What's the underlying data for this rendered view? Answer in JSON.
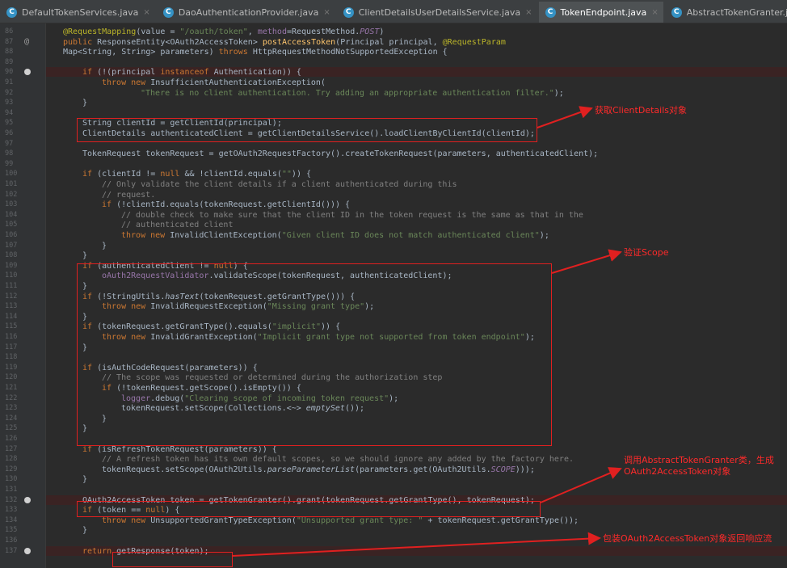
{
  "tabs": [
    {
      "label": "DefaultTokenServices.java",
      "active": false
    },
    {
      "label": "DaoAuthenticationProvider.java",
      "active": false
    },
    {
      "label": "ClientDetailsUserDetailsService.java",
      "active": false
    },
    {
      "label": "TokenEndpoint.java",
      "active": true
    },
    {
      "label": "AbstractTokenGranter.java",
      "active": false
    }
  ],
  "line_numbers": [
    "86",
    "87",
    "88",
    "89",
    "90",
    "91",
    "92",
    "93",
    "94",
    "95",
    "96",
    "97",
    "98",
    "99",
    "100",
    "101",
    "102",
    "103",
    "104",
    "105",
    "106",
    "107",
    "108",
    "109",
    "110",
    "111",
    "112",
    "113",
    "114",
    "115",
    "116",
    "117",
    "118",
    "119",
    "120",
    "121",
    "122",
    "123",
    "124",
    "125",
    "126",
    "127",
    "128",
    "129",
    "130",
    "131",
    "132",
    "133",
    "134",
    "135",
    "136",
    "137"
  ],
  "breakpoint_lines": [
    "90",
    "132",
    "137"
  ],
  "annotation_glyph": "@",
  "code_tokens": [
    [
      "a1",
      [
        "ind",
        0
      ],
      [
        "an",
        "@RequestMapping"
      ],
      [
        "t",
        "(value = "
      ],
      [
        "str",
        "\"/oauth/token\""
      ],
      [
        "t",
        ", "
      ],
      [
        "fld",
        "method"
      ],
      [
        "t",
        "=RequestMethod."
      ],
      [
        "it",
        "POST"
      ],
      [
        "t",
        ")"
      ]
    ],
    [
      "a2",
      [
        "ind",
        0
      ],
      [
        "kw",
        "public "
      ],
      [
        "t",
        "ResponseEntity<OAuth2AccessToken> "
      ],
      [
        "fn",
        "postAccessToken"
      ],
      [
        "t",
        "(Principal principal, "
      ],
      [
        "an",
        "@RequestParam"
      ]
    ],
    [
      "a3",
      [
        "ind",
        0
      ],
      [
        "t",
        "Map<String, String> parameters) "
      ],
      [
        "kw",
        "throws "
      ],
      [
        "t",
        "HttpRequestMethodNotSupportedException {"
      ]
    ],
    [
      "a4"
    ],
    [
      "a5",
      [
        "ind",
        1
      ],
      [
        "kw",
        "if "
      ],
      [
        "t",
        "(!(principal "
      ],
      [
        "kw",
        "instanceof "
      ],
      [
        "t",
        "Authentication)) {"
      ]
    ],
    [
      "a6",
      [
        "ind",
        2
      ],
      [
        "kw",
        "throw new "
      ],
      [
        "t",
        "InsufficientAuthenticationException("
      ]
    ],
    [
      "a7",
      [
        "ind",
        4
      ],
      [
        "str",
        "\"There is no client authentication. Try adding an appropriate authentication filter.\""
      ],
      [
        "t",
        ");"
      ]
    ],
    [
      "a8",
      [
        "ind",
        1
      ],
      [
        "t",
        "}"
      ]
    ],
    [
      "a9"
    ],
    [
      "a10",
      [
        "ind",
        1
      ],
      [
        "t",
        "String clientId = getClientId(principal);"
      ]
    ],
    [
      "a11",
      [
        "ind",
        1
      ],
      [
        "t",
        "ClientDetails authenticatedClient = getClientDetailsService().loadClientByClientId(clientId);"
      ]
    ],
    [
      "a12"
    ],
    [
      "a13",
      [
        "ind",
        1
      ],
      [
        "t",
        "TokenRequest tokenRequest = getOAuth2RequestFactory().createTokenRequest(parameters, authenticatedClient);"
      ]
    ],
    [
      "a14"
    ],
    [
      "a15",
      [
        "ind",
        1
      ],
      [
        "kw",
        "if "
      ],
      [
        "t",
        "(clientId != "
      ],
      [
        "kw",
        "null "
      ],
      [
        "t",
        "&& !clientId.equals("
      ],
      [
        "str",
        "\"\""
      ],
      [
        "t",
        ")) {"
      ]
    ],
    [
      "a16",
      [
        "ind",
        2
      ],
      [
        "cm",
        "// Only validate the client details if a client authenticated during this"
      ]
    ],
    [
      "a17",
      [
        "ind",
        2
      ],
      [
        "cm",
        "// request."
      ]
    ],
    [
      "a18",
      [
        "ind",
        2
      ],
      [
        "kw",
        "if "
      ],
      [
        "t",
        "(!clientId.equals(tokenRequest.getClientId())) {"
      ]
    ],
    [
      "a19",
      [
        "ind",
        3
      ],
      [
        "cm",
        "// double check to make sure that the client ID in the token request is the same as that in the"
      ]
    ],
    [
      "a20",
      [
        "ind",
        3
      ],
      [
        "cm",
        "// authenticated client"
      ]
    ],
    [
      "a21",
      [
        "ind",
        3
      ],
      [
        "kw",
        "throw new "
      ],
      [
        "t",
        "InvalidClientException("
      ],
      [
        "str",
        "\"Given client ID does not match authenticated client\""
      ],
      [
        "t",
        ");"
      ]
    ],
    [
      "a22",
      [
        "ind",
        2
      ],
      [
        "t",
        "}"
      ]
    ],
    [
      "a23",
      [
        "ind",
        1
      ],
      [
        "t",
        "}"
      ]
    ],
    [
      "a24",
      [
        "ind",
        1
      ],
      [
        "kw",
        "if "
      ],
      [
        "t",
        "(authenticatedClient != "
      ],
      [
        "kw",
        "null"
      ],
      [
        "t",
        ") {"
      ]
    ],
    [
      "a25",
      [
        "ind",
        2
      ],
      [
        "fld",
        "oAuth2RequestValidator"
      ],
      [
        "t",
        ".validateScope(tokenRequest, authenticatedClient);"
      ]
    ],
    [
      "a26",
      [
        "ind",
        1
      ],
      [
        "t",
        "}"
      ]
    ],
    [
      "a27",
      [
        "ind",
        1
      ],
      [
        "kw",
        "if "
      ],
      [
        "t",
        "(!StringUtils."
      ],
      [
        "sm",
        "hasText"
      ],
      [
        "t",
        "(tokenRequest.getGrantType())) {"
      ]
    ],
    [
      "a28",
      [
        "ind",
        2
      ],
      [
        "kw",
        "throw new "
      ],
      [
        "t",
        "InvalidRequestException("
      ],
      [
        "str",
        "\"Missing grant type\""
      ],
      [
        "t",
        ");"
      ]
    ],
    [
      "a29",
      [
        "ind",
        1
      ],
      [
        "t",
        "}"
      ]
    ],
    [
      "a30",
      [
        "ind",
        1
      ],
      [
        "kw",
        "if "
      ],
      [
        "t",
        "(tokenRequest.getGrantType().equals("
      ],
      [
        "str",
        "\"implicit\""
      ],
      [
        "t",
        ")) {"
      ]
    ],
    [
      "a31",
      [
        "ind",
        2
      ],
      [
        "kw",
        "throw new "
      ],
      [
        "t",
        "InvalidGrantException("
      ],
      [
        "str",
        "\"Implicit grant type not supported from token endpoint\""
      ],
      [
        "t",
        ");"
      ]
    ],
    [
      "a32",
      [
        "ind",
        1
      ],
      [
        "t",
        "}"
      ]
    ],
    [
      "a33"
    ],
    [
      "a34",
      [
        "ind",
        1
      ],
      [
        "kw",
        "if "
      ],
      [
        "t",
        "(isAuthCodeRequest(parameters)) {"
      ]
    ],
    [
      "a35",
      [
        "ind",
        2
      ],
      [
        "cm",
        "// The scope was requested or determined during the authorization step"
      ]
    ],
    [
      "a36",
      [
        "ind",
        2
      ],
      [
        "kw",
        "if "
      ],
      [
        "t",
        "(!tokenRequest.getScope().isEmpty()) {"
      ]
    ],
    [
      "a37",
      [
        "ind",
        3
      ],
      [
        "fld",
        "logger"
      ],
      [
        "t",
        ".debug("
      ],
      [
        "str",
        "\"Clearing scope of incoming token request\""
      ],
      [
        "t",
        ");"
      ]
    ],
    [
      "a38",
      [
        "ind",
        3
      ],
      [
        "t",
        "tokenRequest.setScope(Collections."
      ],
      [
        "t",
        "<~>"
      ],
      [
        "sm",
        " emptySet"
      ],
      [
        "t",
        "());"
      ]
    ],
    [
      "a39",
      [
        "ind",
        2
      ],
      [
        "t",
        "}"
      ]
    ],
    [
      "a40",
      [
        "ind",
        1
      ],
      [
        "t",
        "}"
      ]
    ],
    [
      "a41"
    ],
    [
      "a42",
      [
        "ind",
        1
      ],
      [
        "kw",
        "if "
      ],
      [
        "t",
        "(isRefreshTokenRequest(parameters)) {"
      ]
    ],
    [
      "a43",
      [
        "ind",
        2
      ],
      [
        "cm",
        "// A refresh token has its own default scopes, so we should ignore any added by the factory here."
      ]
    ],
    [
      "a44",
      [
        "ind",
        2
      ],
      [
        "t",
        "tokenRequest.setScope(OAuth2Utils."
      ],
      [
        "sm",
        "parseParameterList"
      ],
      [
        "t",
        "(parameters.get(OAuth2Utils."
      ],
      [
        "it",
        "SCOPE"
      ],
      [
        "t",
        ")));"
      ]
    ],
    [
      "a45",
      [
        "ind",
        1
      ],
      [
        "t",
        "}"
      ]
    ],
    [
      "a46"
    ],
    [
      "a47",
      [
        "ind",
        1
      ],
      [
        "t",
        "OAuth2AccessToken token = getTokenGranter().grant(tokenRequest.getGrantType(), tokenRequest);"
      ]
    ],
    [
      "a48",
      [
        "ind",
        1
      ],
      [
        "kw",
        "if "
      ],
      [
        "t",
        "(token == "
      ],
      [
        "kw",
        "null"
      ],
      [
        "t",
        ") {"
      ]
    ],
    [
      "a49",
      [
        "ind",
        2
      ],
      [
        "kw",
        "throw new "
      ],
      [
        "t",
        "UnsupportedGrantTypeException("
      ],
      [
        "str",
        "\"Unsupported grant type: \""
      ],
      [
        "t",
        " + tokenRequest.getGrantType());"
      ]
    ],
    [
      "a50",
      [
        "ind",
        1
      ],
      [
        "t",
        "}"
      ]
    ],
    [
      "a51"
    ],
    [
      "a52",
      [
        "ind",
        1
      ],
      [
        "kw",
        "return "
      ],
      [
        "t",
        "getResponse(token);"
      ]
    ]
  ],
  "notes": {
    "n1": "获取ClientDetails对象",
    "n2": "验证Scope",
    "n3a": "调用AbstractTokenGranter类，生成",
    "n3b": "OAuth2AccessToken对象",
    "n4": "包装OAuth2AccessToken对象返回响应流"
  },
  "colors": {
    "annotation_red": "#e02020",
    "breakpoint_highlight": "#3a2323",
    "editor_bg": "#2b2b2b"
  }
}
